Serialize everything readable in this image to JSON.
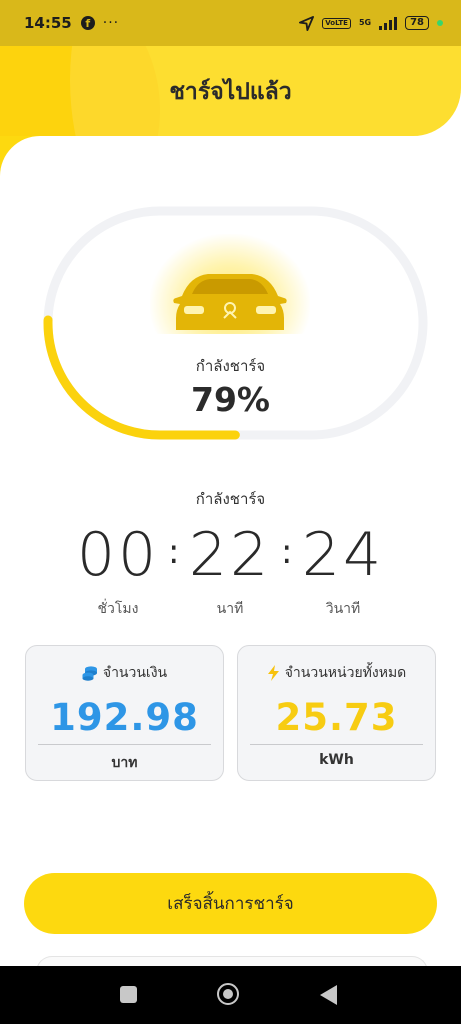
{
  "status_bar": {
    "time": "14:55",
    "fb_glyph": "f",
    "dots": "···",
    "volte_label": "VoLTE",
    "network_label": "5G",
    "battery_level": "78"
  },
  "header": {
    "title": "ชาร์จไปแล้ว"
  },
  "progress": {
    "status_label": "กำลังชาร์จ",
    "percent_text": "79%",
    "percent_value": 79
  },
  "timer": {
    "status_label": "กำลังชาร์จ",
    "hours": "00",
    "minutes": "22",
    "seconds": "24",
    "separator": ":",
    "hours_label": "ชั่วโมง",
    "minutes_label": "นาที",
    "seconds_label": "วินาที"
  },
  "cost_card": {
    "title": "จำนวนเงิน",
    "value": "192.98",
    "unit": "บาท",
    "value_color": "#2e96e6",
    "icon": "coins-icon"
  },
  "energy_card": {
    "title": "จำนวนหน่วยทั้งหมด",
    "value": "25.73",
    "unit": "kWh",
    "value_color": "#f7cc12",
    "icon": "lightning-icon"
  },
  "finish_button": {
    "label": "เสร็จสิ้นการชาร์จ"
  },
  "colors": {
    "brand_yellow": "#fdd90f",
    "ring_track": "#f1f2f5",
    "ring_progress": "#fbd20d"
  }
}
